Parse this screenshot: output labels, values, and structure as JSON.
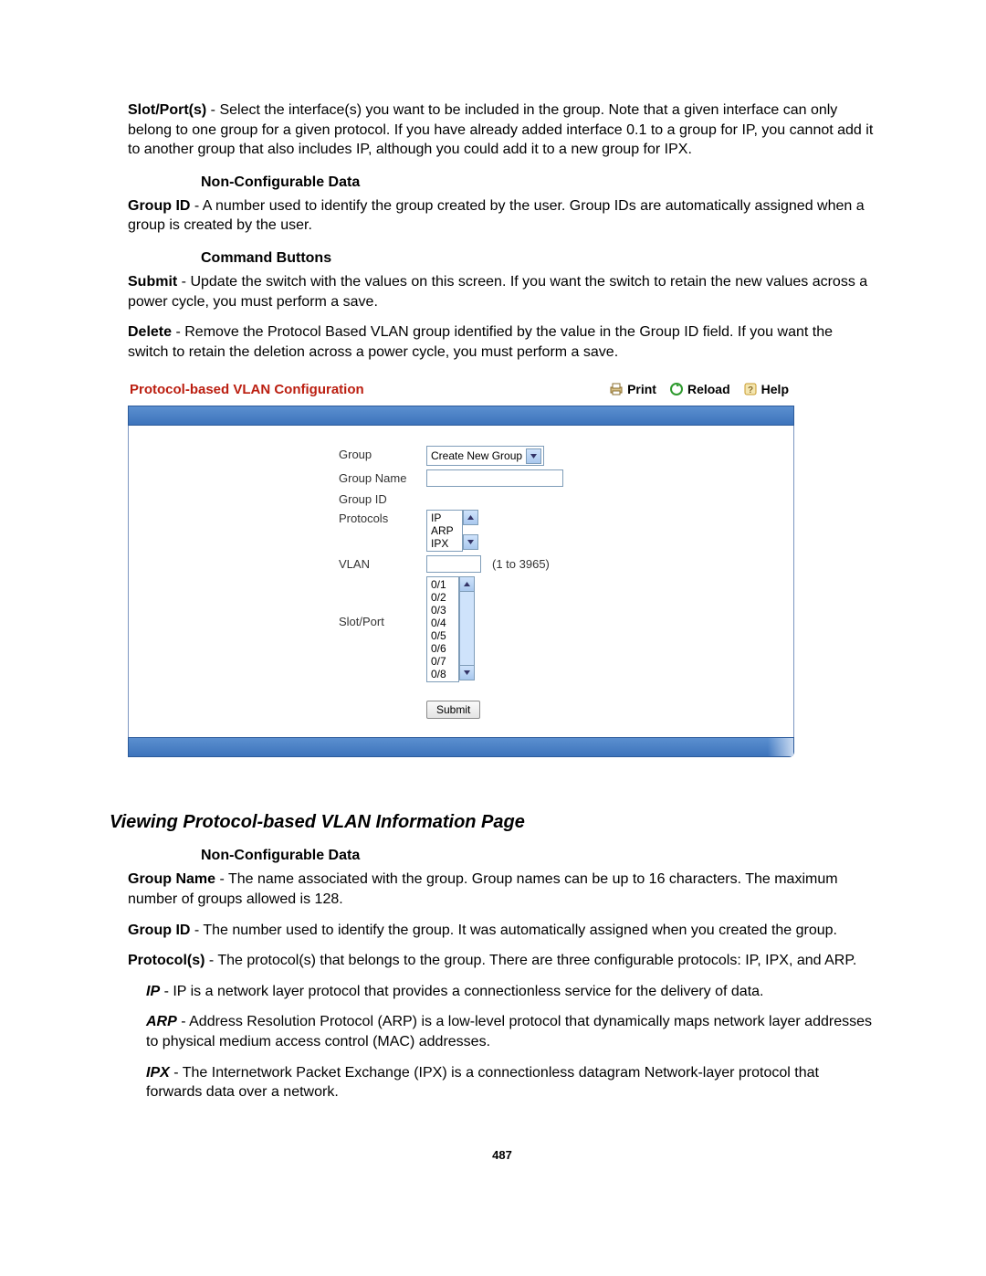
{
  "intro": {
    "slot_port_label": "Slot/Port(s)",
    "slot_port_text": " - Select the interface(s) you want to be included in the group. Note that a given interface can only belong to one group for a given protocol. If you have already added interface 0.1 to a group for IP, you cannot add it to another group that also includes IP, although you could add it to a new group for IPX."
  },
  "ncd1": {
    "heading": "Non-Configurable Data",
    "group_id_label": "Group ID",
    "group_id_text": " - A number used to identify the group created by the user. Group IDs are automatically assigned when a group is created by the user."
  },
  "cmd": {
    "heading": "Command Buttons",
    "submit_label": "Submit",
    "submit_text": " - Update the switch with the values on this screen. If you want the switch to retain the new values across a power cycle, you must perform a save.",
    "delete_label": "Delete",
    "delete_text": " - Remove the Protocol Based VLAN group identified by the value in the Group ID field. If you want the switch to retain the deletion across a power cycle, you must perform a save."
  },
  "panel": {
    "title": "Protocol-based VLAN Configuration",
    "actions": {
      "print": "Print",
      "reload": "Reload",
      "help": "Help"
    },
    "labels": {
      "group": "Group",
      "group_name": "Group Name",
      "group_id": "Group ID",
      "protocols": "Protocols",
      "vlan": "VLAN",
      "slot_port": "Slot/Port"
    },
    "group_select": "Create New Group",
    "protocols": [
      "IP",
      "ARP",
      "IPX"
    ],
    "vlan_hint": "(1 to 3965)",
    "slots": [
      "0/1",
      "0/2",
      "0/3",
      "0/4",
      "0/5",
      "0/6",
      "0/7",
      "0/8"
    ],
    "submit": "Submit"
  },
  "section2": {
    "title": "Viewing Protocol-based VLAN Information Page",
    "ncd_heading": "Non-Configurable Data",
    "group_name_label": "Group Name",
    "group_name_text": " - The name associated with the group. Group names can be up to 16 characters. The maximum number of groups allowed is 128.",
    "group_id_label": "Group ID",
    "group_id_text": " - The number used to identify the group. It was automatically assigned when you created the group.",
    "protocols_label": "Protocol(s)",
    "protocols_text": " - The protocol(s) that belongs to the group. There are three configurable protocols: IP, IPX, and ARP.",
    "ip_label": "IP",
    "ip_text": " - IP is a network layer protocol that provides a connectionless service for the delivery of data.",
    "arp_label": "ARP",
    "arp_text": " - Address Resolution Protocol (ARP) is a low-level protocol that dynamically maps network layer addresses to physical medium access control (MAC) addresses.",
    "ipx_label": "IPX",
    "ipx_text": " - The Internetwork Packet Exchange (IPX) is a connectionless datagram Network-layer protocol that forwards data over a network."
  },
  "page_number": "487"
}
